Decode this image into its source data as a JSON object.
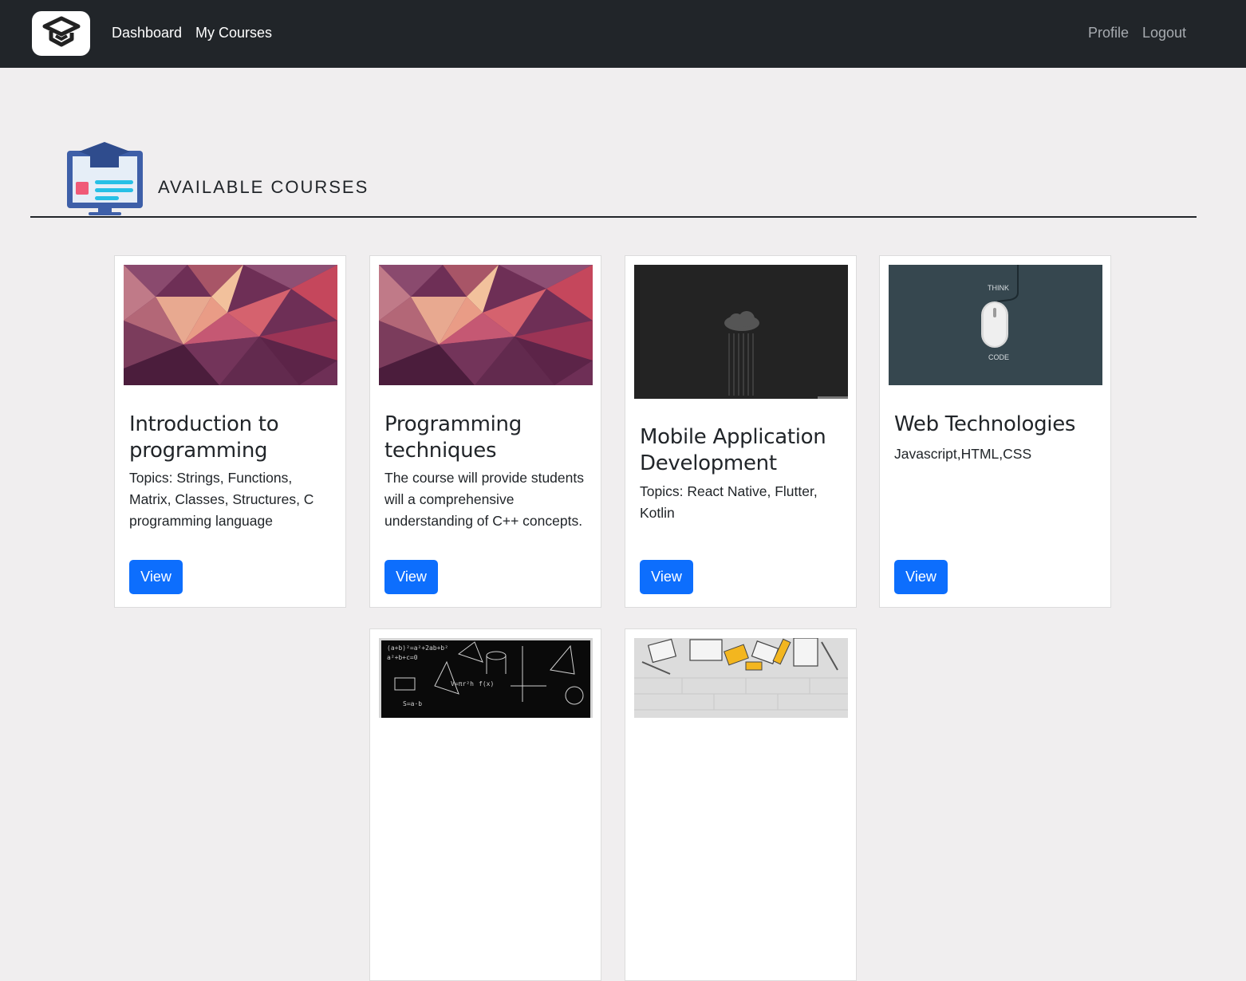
{
  "nav": {
    "logo_icon": "graduation-cap-logo",
    "dashboard": "Dashboard",
    "my_courses": "My Courses",
    "profile": "Profile",
    "logout": "Logout"
  },
  "page": {
    "header_icon": "course-monitor-icon",
    "title": "AVAILABLE COURSES"
  },
  "courses": [
    {
      "title": "Introduction to programming",
      "description": "Topics: Strings, Functions, Matrix, Classes, Structures, C programming language",
      "button": "View",
      "image": "low-poly-pink"
    },
    {
      "title": "Programming techniques",
      "description": "The course will provide students will a comprehensive understanding of C++ concepts.",
      "button": "View",
      "image": "low-poly-pink"
    },
    {
      "title": "Mobile Application Development",
      "description": "Topics: React Native, Flutter, Kotlin",
      "button": "View",
      "image": "binary-rain-cloud"
    },
    {
      "title": "Web Technologies",
      "description": "Javascript,HTML,CSS",
      "button": "View",
      "image": "think-mouse-code",
      "image_text_top": "THINK",
      "image_text_bottom": "CODE"
    },
    {
      "title": "",
      "description": "",
      "button": "",
      "image": "chalkboard-math"
    },
    {
      "title": "",
      "description": "",
      "button": "",
      "image": "desk-sketch"
    }
  ],
  "colors": {
    "navbar": "#212529",
    "background": "#f0eeef",
    "button": "#0d6efd"
  }
}
